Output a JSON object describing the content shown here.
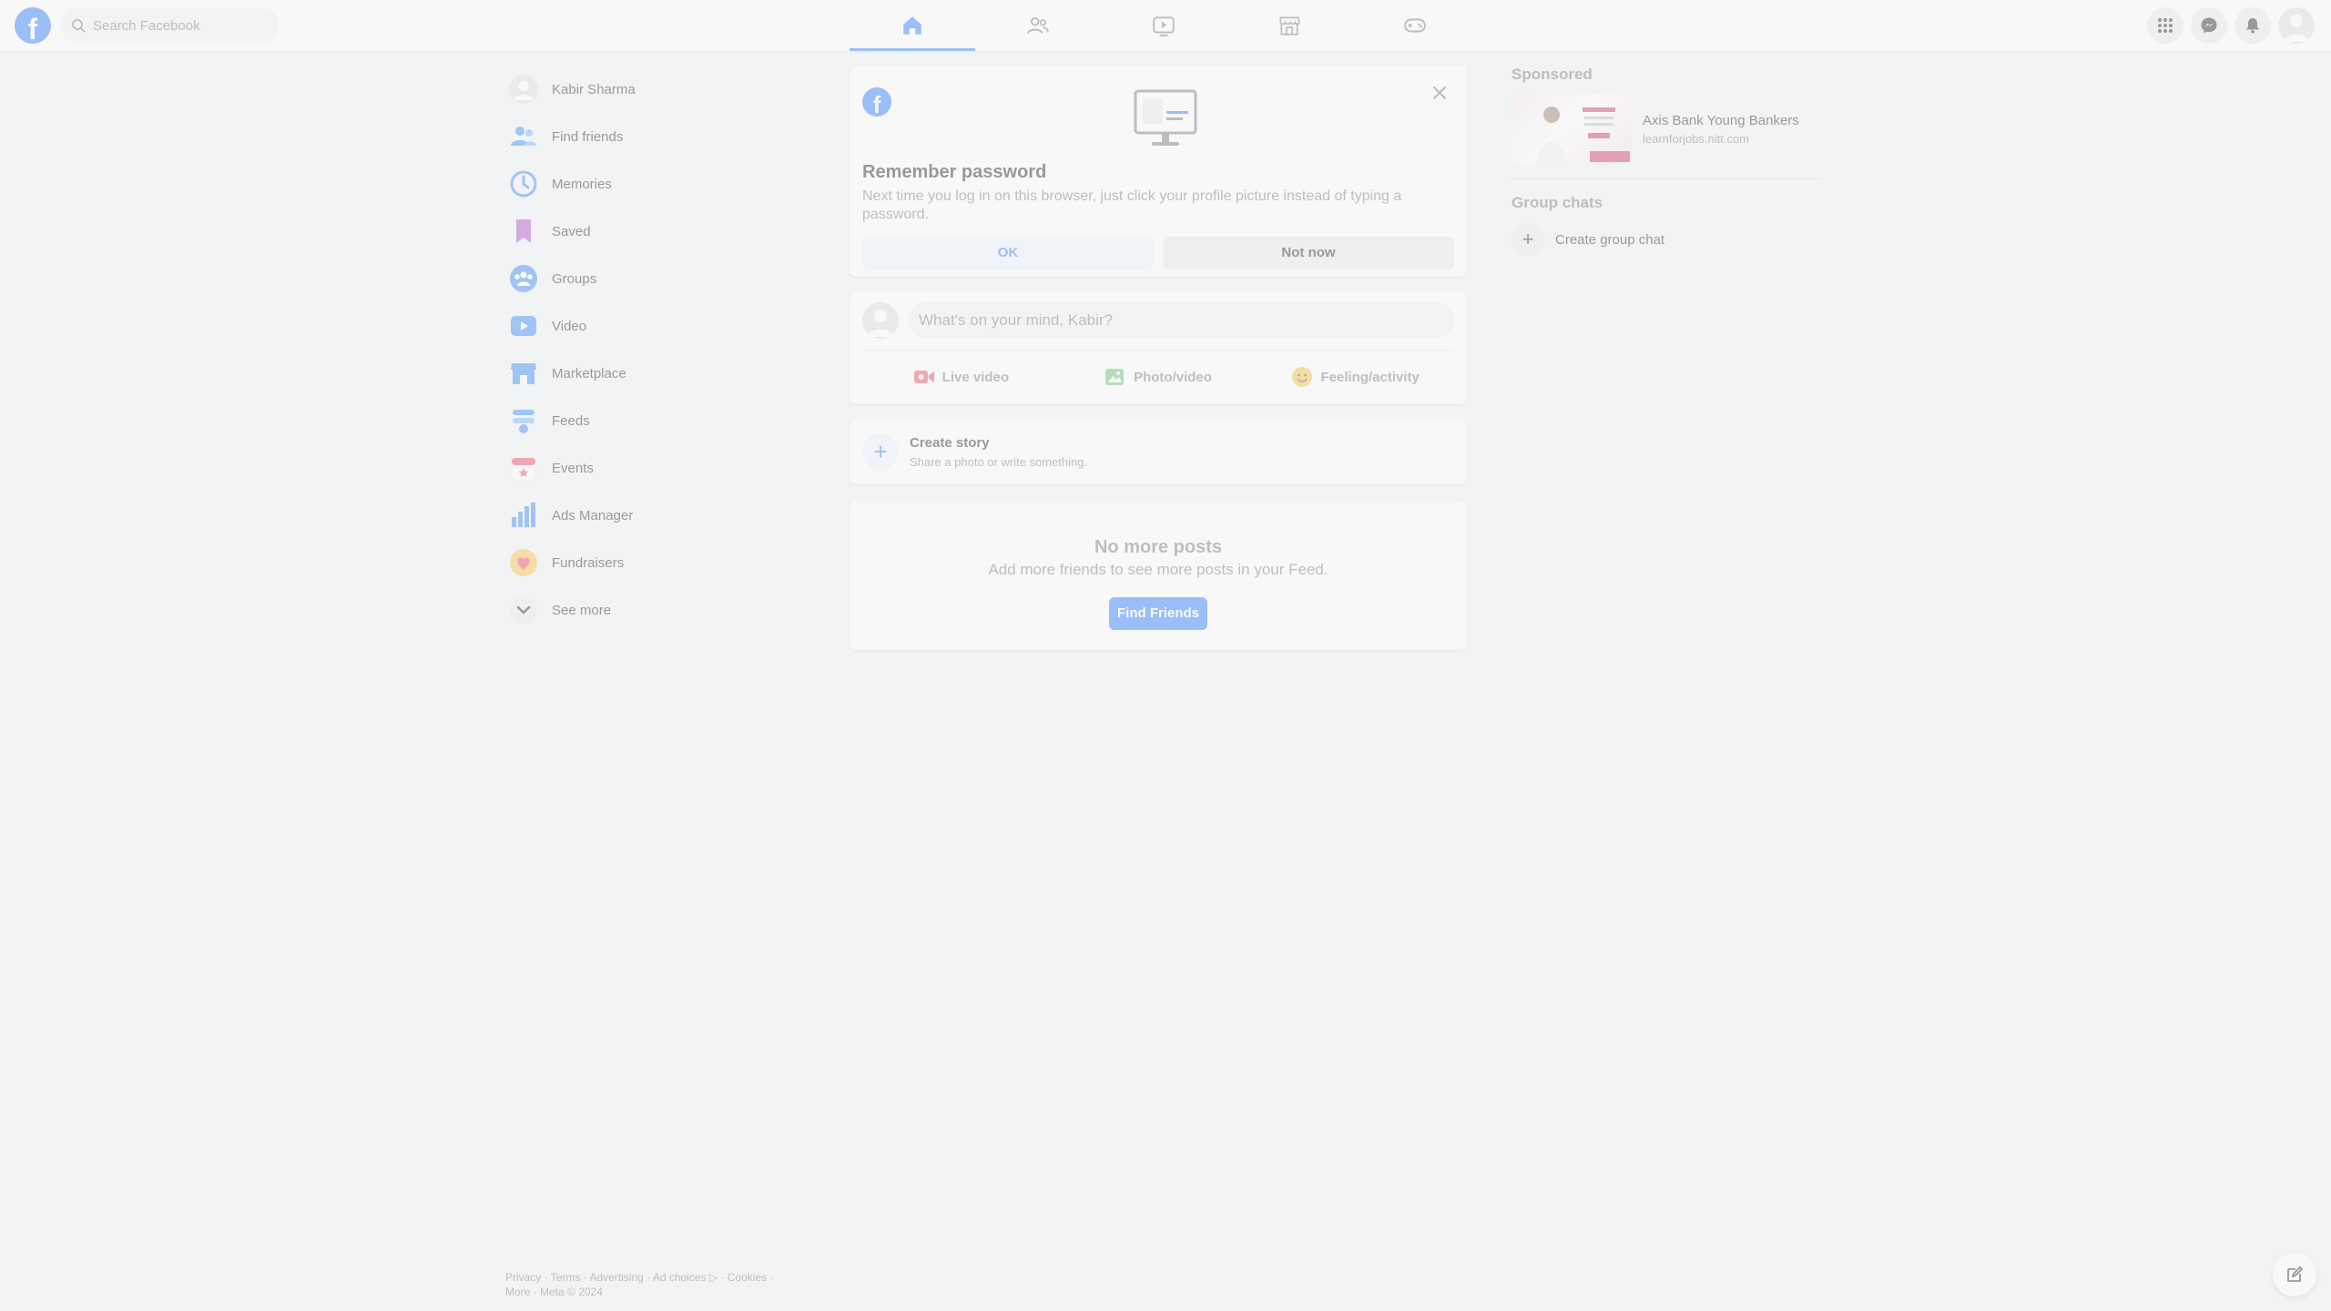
{
  "topbar": {
    "logo": "f",
    "search_placeholder": "Search Facebook",
    "nav_tabs": [
      {
        "name": "home",
        "active": true
      },
      {
        "name": "friends",
        "active": false
      },
      {
        "name": "video",
        "active": false
      },
      {
        "name": "marketplace",
        "active": false
      },
      {
        "name": "gaming",
        "active": false
      }
    ],
    "right_icons": [
      "menu-grid-icon",
      "messenger-icon",
      "bell-icon",
      "account-avatar"
    ]
  },
  "sidebar": {
    "items": [
      {
        "label": "Kabir Sharma",
        "icon": "avatar"
      },
      {
        "label": "Find friends",
        "icon": "friends-icon"
      },
      {
        "label": "Memories",
        "icon": "clock-icon"
      },
      {
        "label": "Saved",
        "icon": "bookmark-icon"
      },
      {
        "label": "Groups",
        "icon": "groups-icon"
      },
      {
        "label": "Video",
        "icon": "video-icon"
      },
      {
        "label": "Marketplace",
        "icon": "store-icon"
      },
      {
        "label": "Feeds",
        "icon": "feeds-icon"
      },
      {
        "label": "Events",
        "icon": "calendar-icon"
      },
      {
        "label": "Ads Manager",
        "icon": "bar-chart-icon"
      },
      {
        "label": "Fundraisers",
        "icon": "heart-icon"
      },
      {
        "label": "See more",
        "icon": "chevron-down-icon"
      }
    ],
    "footer_line1": "Privacy · Terms · Advertising · Ad choices ▷ · Cookies ·",
    "footer_line2": "More · Meta © 2024"
  },
  "remember_password": {
    "title": "Remember password",
    "description": "Next time you log in on this browser, just click your profile picture instead of typing a password.",
    "ok_label": "OK",
    "not_now_label": "Not now"
  },
  "composer": {
    "placeholder": "What's on your mind, Kabir?",
    "actions": [
      {
        "label": "Live video",
        "color": "#f02849"
      },
      {
        "label": "Photo/video",
        "color": "#45bd62"
      },
      {
        "label": "Feeling/activity",
        "color": "#f7b928"
      }
    ]
  },
  "story": {
    "title": "Create story",
    "subtitle": "Share a photo or write something."
  },
  "no_more_posts": {
    "title": "No more posts",
    "subtitle": "Add more friends to see more posts in your Feed.",
    "button_label": "Find Friends"
  },
  "right_column": {
    "sponsored_heading": "Sponsored",
    "sponsor_name": "Axis Bank Young Bankers",
    "sponsor_url": "learnforjobs.nitt.com",
    "group_chats_heading": "Group chats",
    "create_group_label": "Create group chat"
  },
  "colors": {
    "brand": "#0866ff",
    "background": "#f0f2f5"
  }
}
